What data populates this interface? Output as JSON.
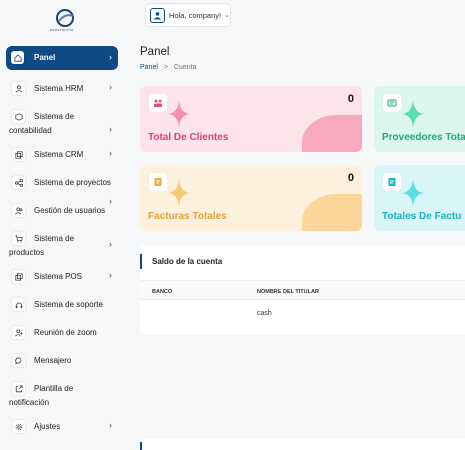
{
  "brand": {
    "logo_text": "PROSTRUCTA"
  },
  "header": {
    "user_greeting": "Hola, company!"
  },
  "page": {
    "title": "Panel",
    "breadcrumb_home": "Panel",
    "breadcrumb_sep": ">",
    "breadcrumb_current": "Cuenta"
  },
  "sidebar": {
    "items": [
      {
        "label": "Panel",
        "icon": "home-icon"
      },
      {
        "label": "Sistema HRM",
        "icon": "user-icon"
      },
      {
        "label_line1": "Sistema de",
        "label_line2": "contabilidad",
        "icon": "box-icon"
      },
      {
        "label": "Sistema CRM",
        "icon": "layers-icon"
      },
      {
        "label": "Sistema de proyectos",
        "icon": "share-icon"
      },
      {
        "label": "Gestión de usuarios",
        "icon": "users-icon"
      },
      {
        "label_line1": "Sistema de",
        "label_line2": "productos",
        "icon": "cart-icon"
      },
      {
        "label": "Sistema POS",
        "icon": "layers-icon"
      },
      {
        "label": "Sistema de soporte",
        "icon": "headset-icon"
      },
      {
        "label": "Reunión de zoom",
        "icon": "user-plus-icon"
      },
      {
        "label": "Mensajero",
        "icon": "message-icon"
      },
      {
        "label_line1": "Plantilla de",
        "label_line2": "notificación",
        "icon": "external-icon"
      },
      {
        "label": "Ajustes",
        "icon": "gear-icon"
      }
    ]
  },
  "cards": [
    {
      "title": "Total De Clientes",
      "count": "0",
      "bg": "#fde4ea",
      "accent": "#f06292",
      "text": "#d8417a"
    },
    {
      "title": "Proveedores Tota",
      "count": "",
      "bg": "#dcf7ee",
      "accent": "#3fcf9a",
      "text": "#1faa78"
    },
    {
      "title": "Facturas Totales",
      "count": "0",
      "bg": "#fdf0dc",
      "accent": "#f7bf63",
      "text": "#e0a23b"
    },
    {
      "title": "Totales De Factu",
      "count": "",
      "bg": "#daf5f7",
      "accent": "#3fd1d8",
      "text": "#19b5bd"
    }
  ],
  "account": {
    "title": "Saldo de la cuenta",
    "columns": [
      "BANCO",
      "NOMBRE DEL TITULAR"
    ],
    "rows": [
      [
        "",
        "cash"
      ]
    ]
  }
}
